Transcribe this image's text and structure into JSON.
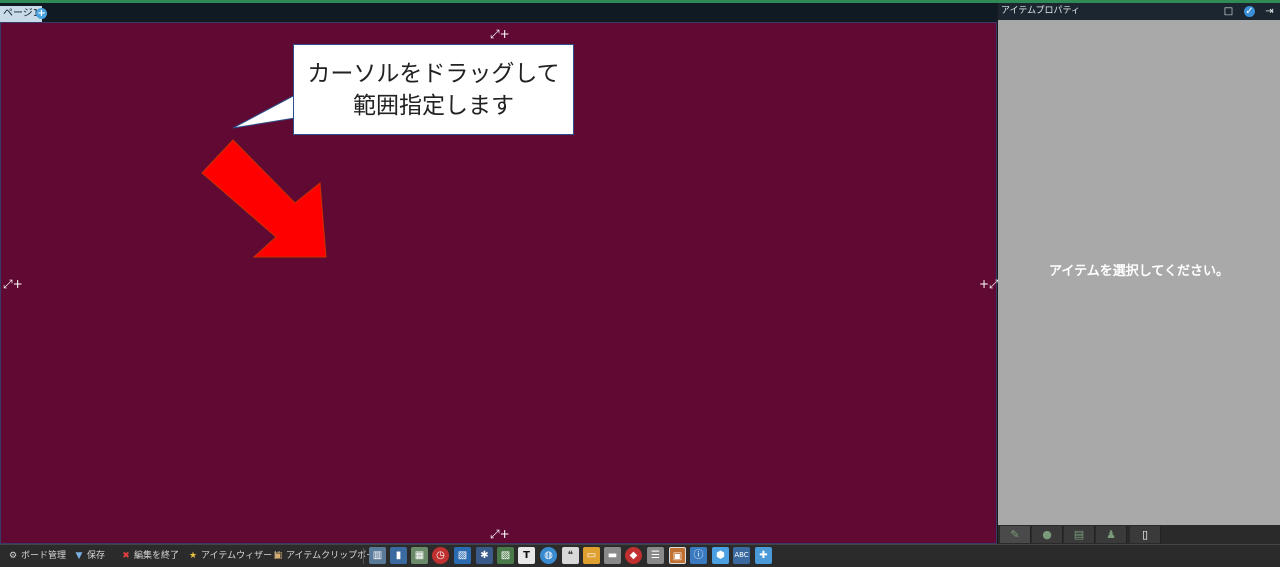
{
  "tabs": {
    "page_tab": "ページ1",
    "add_icon": "plus-circle-icon"
  },
  "callout": {
    "text": "カーソルをドラッグして範囲指定します"
  },
  "panel": {
    "title": "アイテムプロパティ",
    "empty_message": "アイテムを選択してください。",
    "tabs": [
      "pencil-icon",
      "globe-icon",
      "database-icon",
      "user-icon",
      "document-icon"
    ]
  },
  "bottom": {
    "items": [
      {
        "label": "ボード管理",
        "icon": "gear-icon"
      },
      {
        "label": "保存",
        "icon": "trash-icon"
      },
      {
        "label": "編集を終了",
        "icon": "close-icon"
      },
      {
        "label": "アイテムウィザード",
        "icon": "star-icon"
      },
      {
        "label": "アイテムクリップボード",
        "icon": "clipboard-icon"
      }
    ],
    "tools": [
      "layout-icon",
      "bar-chart-icon",
      "table-icon",
      "clock-icon",
      "image-icon",
      "diagram-icon",
      "photo-icon",
      "text-icon",
      "web-icon",
      "chat-icon",
      "folder-icon",
      "button-icon",
      "shapes-icon",
      "list-icon",
      "dashboard-icon",
      "info-icon",
      "cube-icon",
      "spellcheck-icon",
      "plugin-icon"
    ],
    "text_tool_label": "T",
    "spell_tool_label": "ABC"
  },
  "colors": {
    "board_bg": "#600a33",
    "arrow": "#ff0000",
    "panel_bg": "#a9a9a9"
  }
}
